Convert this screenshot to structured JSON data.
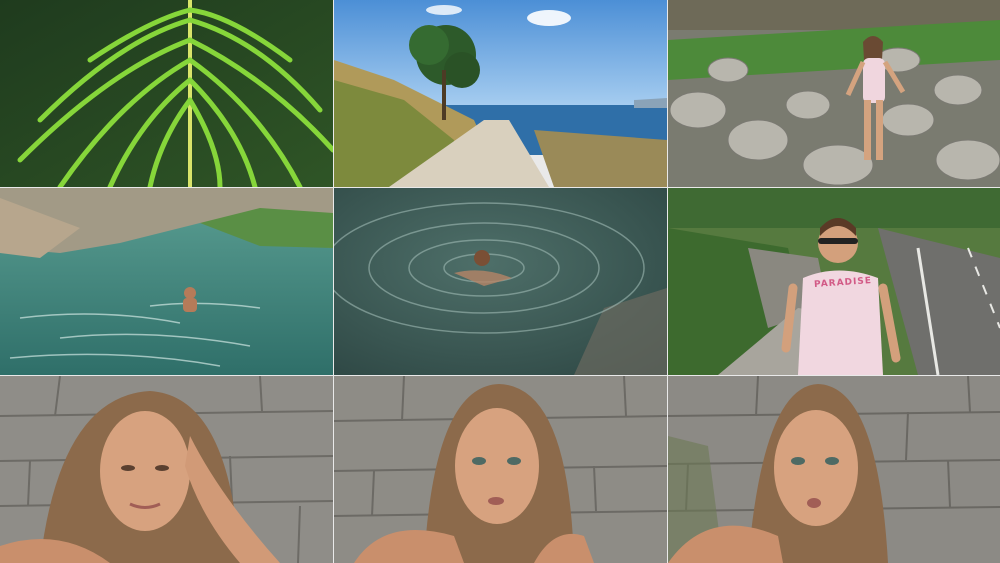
{
  "collage": {
    "rows": 3,
    "columns": 3,
    "tiles": [
      {
        "scene": "palm-frond"
      },
      {
        "scene": "coastal-road"
      },
      {
        "scene": "rocky-slope-woman"
      },
      {
        "scene": "lake-swimmer"
      },
      {
        "scene": "swimmer-ripples"
      },
      {
        "scene": "roadside-woman"
      },
      {
        "scene": "selfie-stone-wall"
      },
      {
        "scene": "selfie-stone-wall"
      },
      {
        "scene": "selfie-stone-wall"
      }
    ],
    "shirt_print": "PARADISE",
    "colors": {
      "divider": "#e9e9e9",
      "palm": "#7fcf2f",
      "sea": "#3b83b8",
      "lake": "#3f8f86",
      "stone": "#8f8d88",
      "skin": "#d7a27f",
      "hair": "#8c6a4b"
    }
  }
}
